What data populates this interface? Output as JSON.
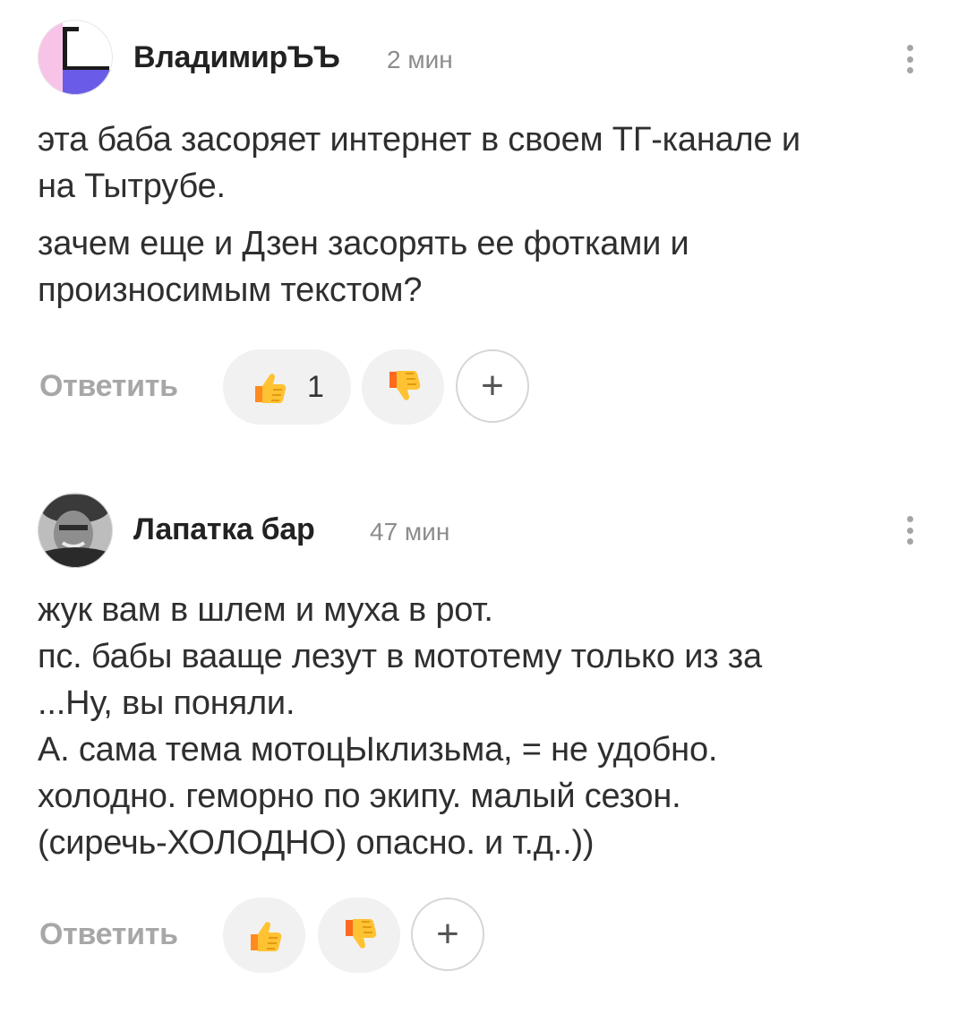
{
  "comments": [
    {
      "author": "ВладимирЪЪ",
      "time": "2 мин",
      "paragraphs": [
        "эта баба засоряет интернет в своем ТГ-канале и\nна Тытрубе.",
        "зачем еще и Дзен засорять ее фотками и\nпроизносимым текстом?"
      ],
      "reply_label": "Ответить",
      "likes": "1",
      "avatar_icon": "letter-g-avatar-icon"
    },
    {
      "author": "Лапатка бар",
      "time": "47 мин",
      "lines": [
        "жук вам в шлем и муха в рот.",
        "пс. бабы вааще лезут в мототему только из за",
        "...Ну, вы поняли.",
        "А. сама тема мотоцЫклизьма, = не удобно.",
        "холодно. геморно по экипу. малый сезон.",
        "(сиречь-ХОЛОДНО) опасно. и т.д..))"
      ],
      "reply_label": "Ответить",
      "avatar_icon": "photo-avatar-icon"
    }
  ],
  "icons": {
    "like": "thumbs-up-icon",
    "dislike": "thumbs-down-icon",
    "add_reaction": "plus-icon",
    "more": "more-vertical-icon"
  },
  "colors": {
    "avatar_pink": "#f7c4e8",
    "avatar_purple": "#6b5ce7",
    "meta_gray": "#8c8c8c",
    "reply_gray": "#a7a7a7",
    "pill_bg": "#f1f1f1"
  }
}
